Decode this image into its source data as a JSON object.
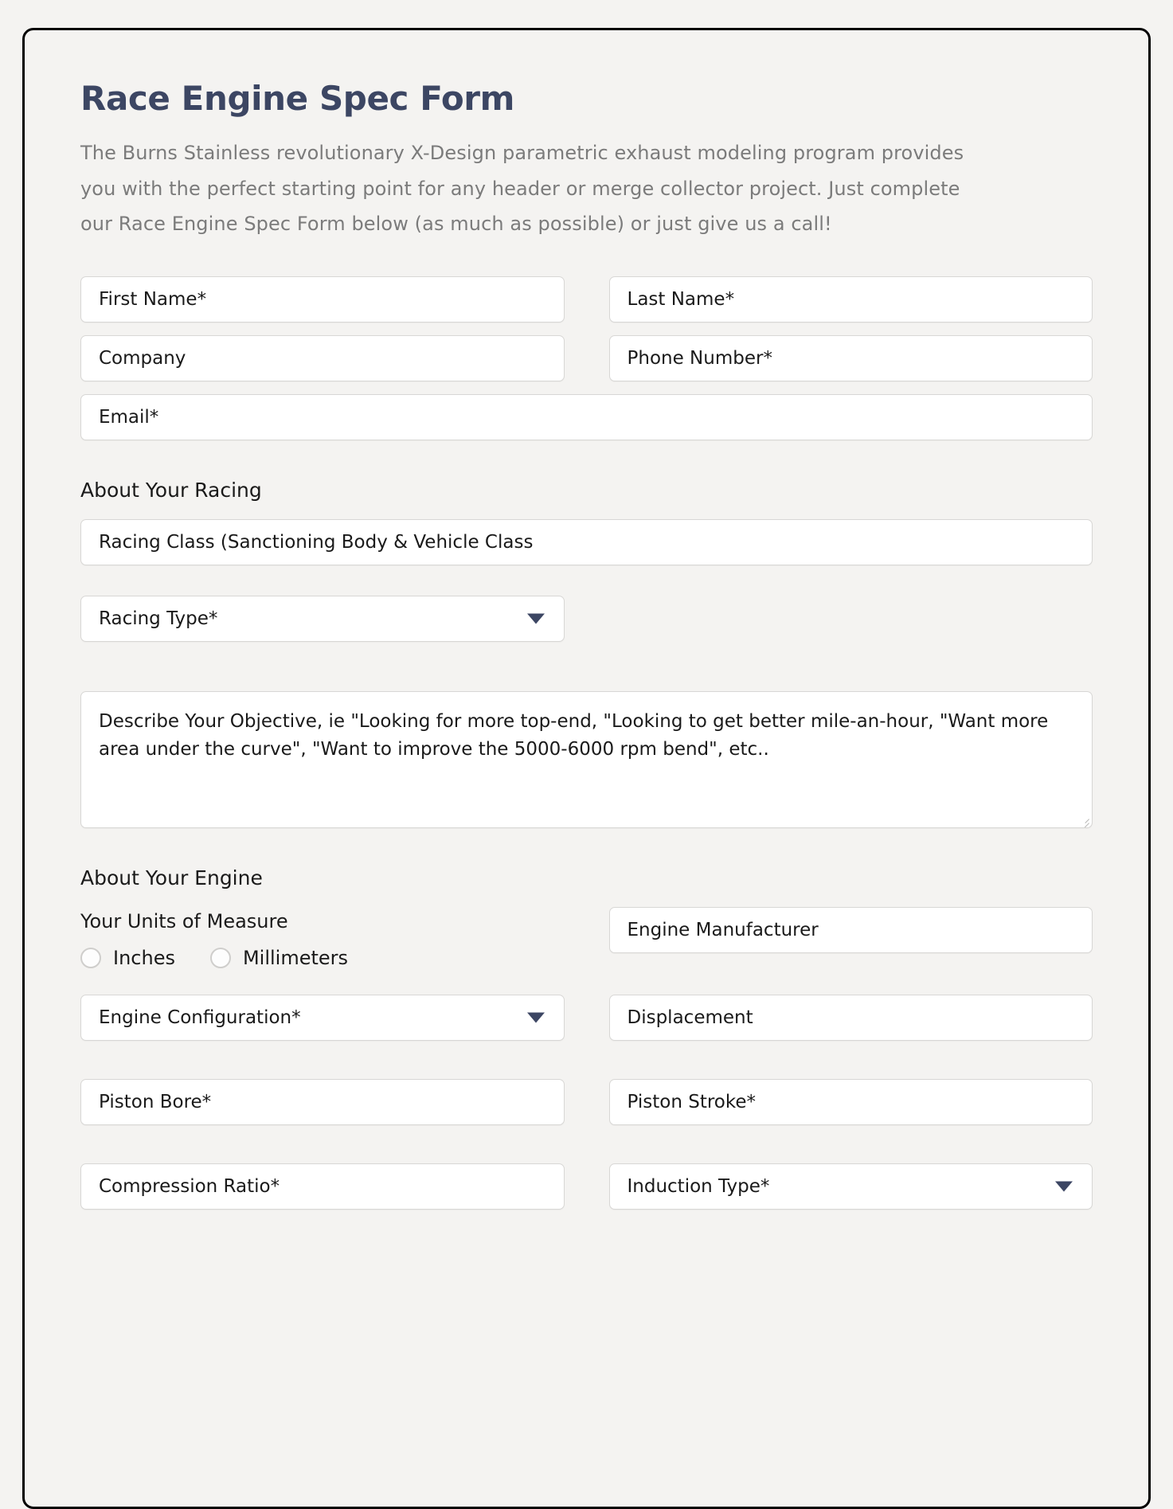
{
  "header": {
    "title": "Race Engine Spec Form",
    "intro": "The Burns Stainless revolutionary X-Design parametric exhaust modeling program provides you with the perfect starting point for any header or merge collector project. Just complete our Race Engine Spec Form below (as much as possible) or just give us a call!"
  },
  "contact": {
    "first_name_placeholder": "First Name*",
    "last_name_placeholder": "Last Name*",
    "company_placeholder": "Company",
    "phone_placeholder": "Phone Number*",
    "email_placeholder": "Email*"
  },
  "racing": {
    "section_title": "About Your Racing",
    "racing_class_placeholder": "Racing Class (Sanctioning Body & Vehicle Class",
    "racing_type_placeholder": "Racing Type*",
    "objective_placeholder": "Describe Your Objective, ie \"Looking for more top-end, \"Looking to get better mile-an-hour, \"Want more area under the curve\", \"Want to improve the 5000-6000 rpm bend\", etc.."
  },
  "engine": {
    "section_title": "About Your Engine",
    "units_label": "Your Units of Measure",
    "units_options": [
      "Inches",
      "Millimeters"
    ],
    "engine_manufacturer_placeholder": "Engine Manufacturer",
    "engine_configuration_placeholder": "Engine Configuration*",
    "displacement_placeholder": "Displacement",
    "piston_bore_placeholder": "Piston Bore*",
    "piston_stroke_placeholder": "Piston Stroke*",
    "compression_ratio_placeholder": "Compression Ratio*",
    "induction_type_placeholder": "Induction Type*"
  },
  "colors": {
    "title": "#3c4663",
    "intro_text": "#7b7b7b",
    "background": "#f4f3f1",
    "field_background": "#ffffff",
    "field_border": "#d8d7d5",
    "arrow": "#3c4663",
    "frame_border": "#000000"
  }
}
